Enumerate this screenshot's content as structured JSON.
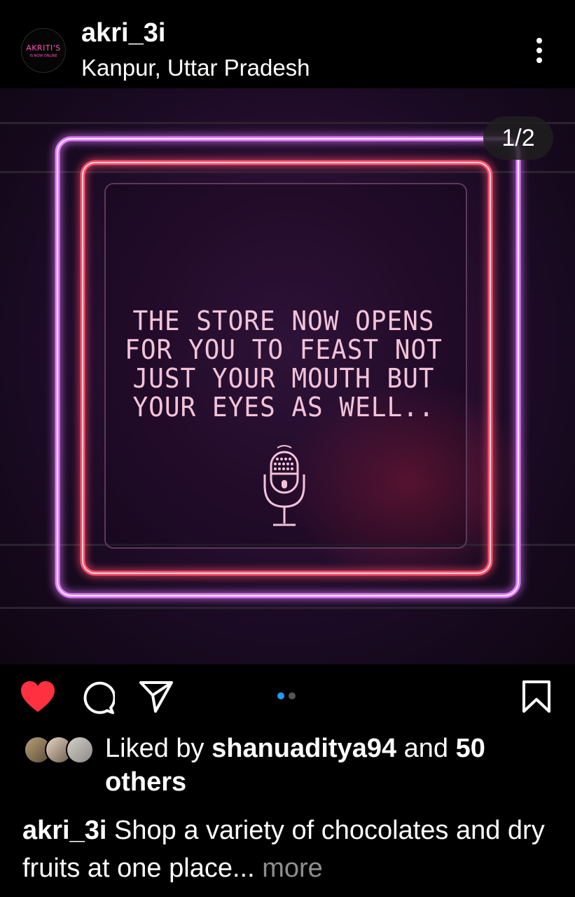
{
  "header": {
    "avatar_brand": "AKRITI'S",
    "avatar_sub": "IS NOW ONLINE",
    "username": "akri_3i",
    "location": "Kanpur, Uttar Pradesh",
    "more_icon": "more-vertical-icon"
  },
  "post": {
    "counter": "1/2",
    "tagline": [
      "THE STORE NOW OPENS",
      "FOR YOU TO FEAST NOT",
      "JUST YOUR MOUTH BUT",
      "YOUR EYES AS WELL.."
    ],
    "image_icon": "microphone-icon",
    "colors": {
      "neon_purple": "#e07cff",
      "neon_red": "#ff4d6a",
      "text": "#f2c3d8"
    }
  },
  "actions": {
    "like_icon": "heart-icon",
    "liked": true,
    "like_color": "#ff3040",
    "comment_icon": "comment-icon",
    "share_icon": "send-icon",
    "save_icon": "bookmark-icon",
    "carousel_total": 2,
    "carousel_active": 1,
    "active_dot_color": "#1d9bf0"
  },
  "likes": {
    "prefix": "Liked by ",
    "user": "shanuaditya94",
    "middle": " and ",
    "count": "50",
    "suffix": "others"
  },
  "caption": {
    "username": "akri_3i",
    "text": " Shop a variety of chocolates and dry fruits at one place",
    "ellipsis": "...",
    "more": " more"
  }
}
